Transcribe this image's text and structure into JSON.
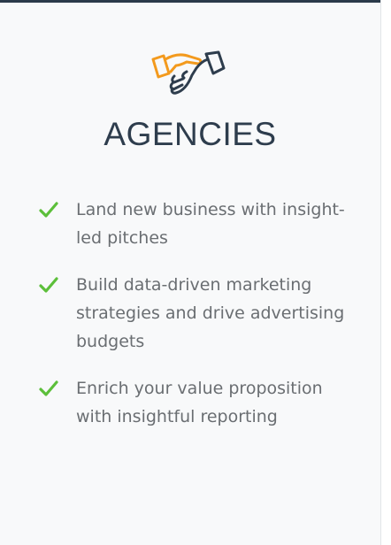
{
  "card": {
    "title": "AGENCIES",
    "icon": "handshake-icon",
    "accent_color": "#f39a1d",
    "check_color": "#5cbf3a",
    "features": [
      {
        "icon": "check-icon",
        "text": "Land new business with insight-led pitches"
      },
      {
        "icon": "check-icon",
        "text": "Build data-driven marketing strategies and drive advertising budgets"
      },
      {
        "icon": "check-icon",
        "text": "Enrich your value proposition with insightful reporting"
      }
    ]
  }
}
